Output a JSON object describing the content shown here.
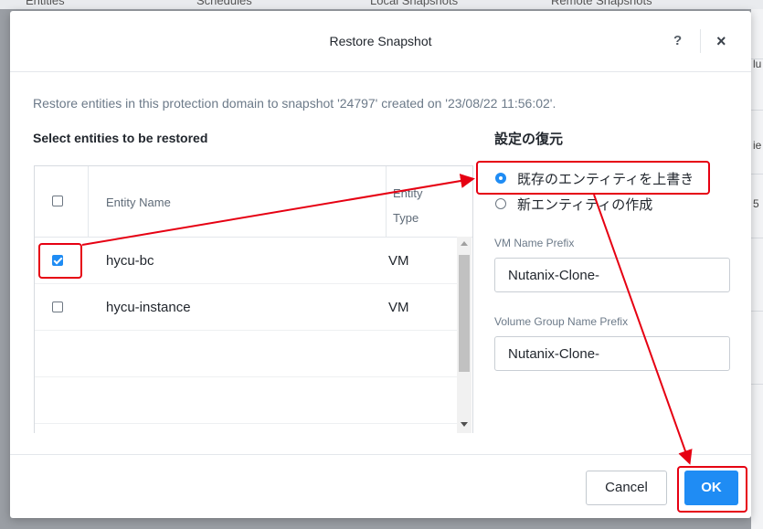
{
  "background": {
    "tabs": [
      "Entities",
      "Schedules",
      "Local Snapshots",
      "Remote Snapshots"
    ],
    "right_fragments": [
      "lu",
      "ie",
      "5"
    ]
  },
  "dialog": {
    "title": "Restore Snapshot",
    "help": "?",
    "close": "×",
    "description": "Restore entities in this protection domain to snapshot '24797' created on '23/08/22 11:56:02'.",
    "select_heading": "Select entities to be restored",
    "table": {
      "col_name": "Entity Name",
      "col_type": "Entity Type",
      "rows": [
        {
          "name": "hycu-bc",
          "type": "VM",
          "checked": true
        },
        {
          "name": "hycu-instance",
          "type": "VM",
          "checked": false
        }
      ]
    },
    "restore_settings": {
      "heading": "設定の復元",
      "options": [
        {
          "label": "既存のエンティティを上書き",
          "selected": true
        },
        {
          "label": "新エンティティの作成",
          "selected": false
        }
      ],
      "vm_prefix_label": "VM Name Prefix",
      "vm_prefix_value": "Nutanix-Clone-",
      "vg_prefix_label": "Volume Group Name Prefix",
      "vg_prefix_value": "Nutanix-Clone-"
    },
    "buttons": {
      "cancel": "Cancel",
      "ok": "OK"
    }
  },
  "colors": {
    "accent": "#1f8cf4",
    "annotation": "#e60012"
  }
}
